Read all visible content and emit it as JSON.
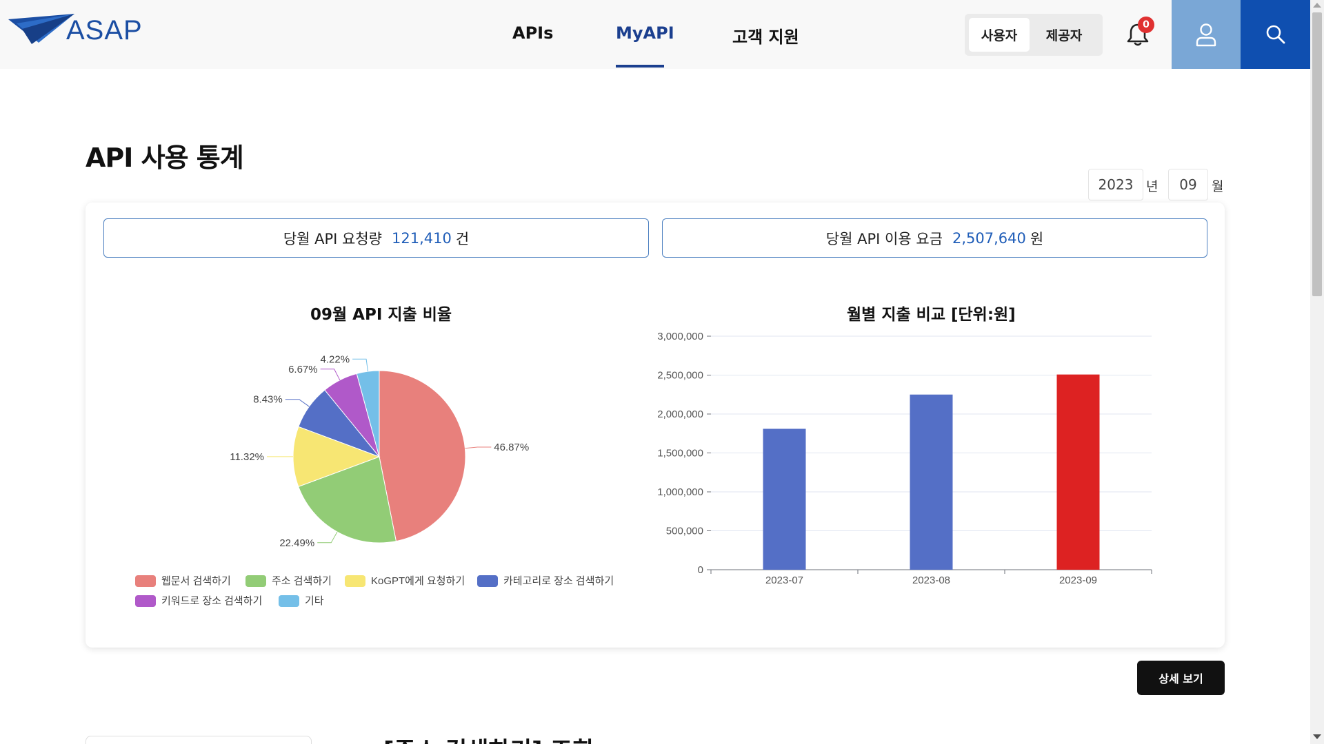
{
  "header": {
    "logo_text": "ASAP",
    "nav": [
      {
        "label": "APIs"
      },
      {
        "label": "MyAPI"
      },
      {
        "label": "고객 지원"
      }
    ],
    "roles": [
      "사용자",
      "제공자"
    ],
    "notification_count": "0",
    "colors": {
      "brand": "#1b4ea3",
      "user_button": "#7aa7d6",
      "search_button": "#0f4fb0",
      "active_nav": "#1b3f8f"
    }
  },
  "page": {
    "title": "API 사용 통계",
    "year": "2023",
    "year_unit": "년",
    "month": "09",
    "month_unit": "월"
  },
  "summary": {
    "requests_label": "당월 API 요청량",
    "requests_value": "121,410",
    "requests_unit": "건",
    "fee_label": "당월 API 이용 요금",
    "fee_value": "2,507,640",
    "fee_unit": "원"
  },
  "chart_data": [
    {
      "type": "pie",
      "title": "09월 API 지출 비율",
      "labels": [
        "웹문서 검색하기",
        "주소 검색하기",
        "KoGPT에게 요청하기",
        "카테고리로 장소 검색하기",
        "키워드로 장소 검색하기",
        "기타"
      ],
      "values": [
        46.87,
        22.49,
        11.32,
        8.43,
        6.67,
        4.22
      ],
      "value_labels": [
        "46.87%",
        "22.49%",
        "11.32%",
        "8.43%",
        "6.67%",
        "4.22%"
      ],
      "colors": [
        "#e8807c",
        "#92cc76",
        "#f7e673",
        "#546fc6",
        "#b059c9",
        "#74bfe8"
      ],
      "legend": "bottom"
    },
    {
      "type": "bar",
      "title": "월별 지출 비교 [단위:원]",
      "categories": [
        "2023-07",
        "2023-08",
        "2023-09"
      ],
      "values": [
        1810000,
        2250000,
        2507640
      ],
      "colors": [
        "#546fc6",
        "#546fc6",
        "#dd2222"
      ],
      "ylim": [
        0,
        3000000
      ],
      "yticks": [
        0,
        500000,
        1000000,
        1500000,
        2000000,
        2500000,
        3000000
      ],
      "ytick_labels": [
        "0",
        "500,000",
        "1,000,000",
        "1,500,000",
        "2,000,000",
        "2,500,000",
        "3,000,000"
      ],
      "grid": true
    }
  ],
  "actions": {
    "detail_label": "상세 보기"
  },
  "next_section": {
    "heading": "[주소 검색하기] 조회"
  }
}
